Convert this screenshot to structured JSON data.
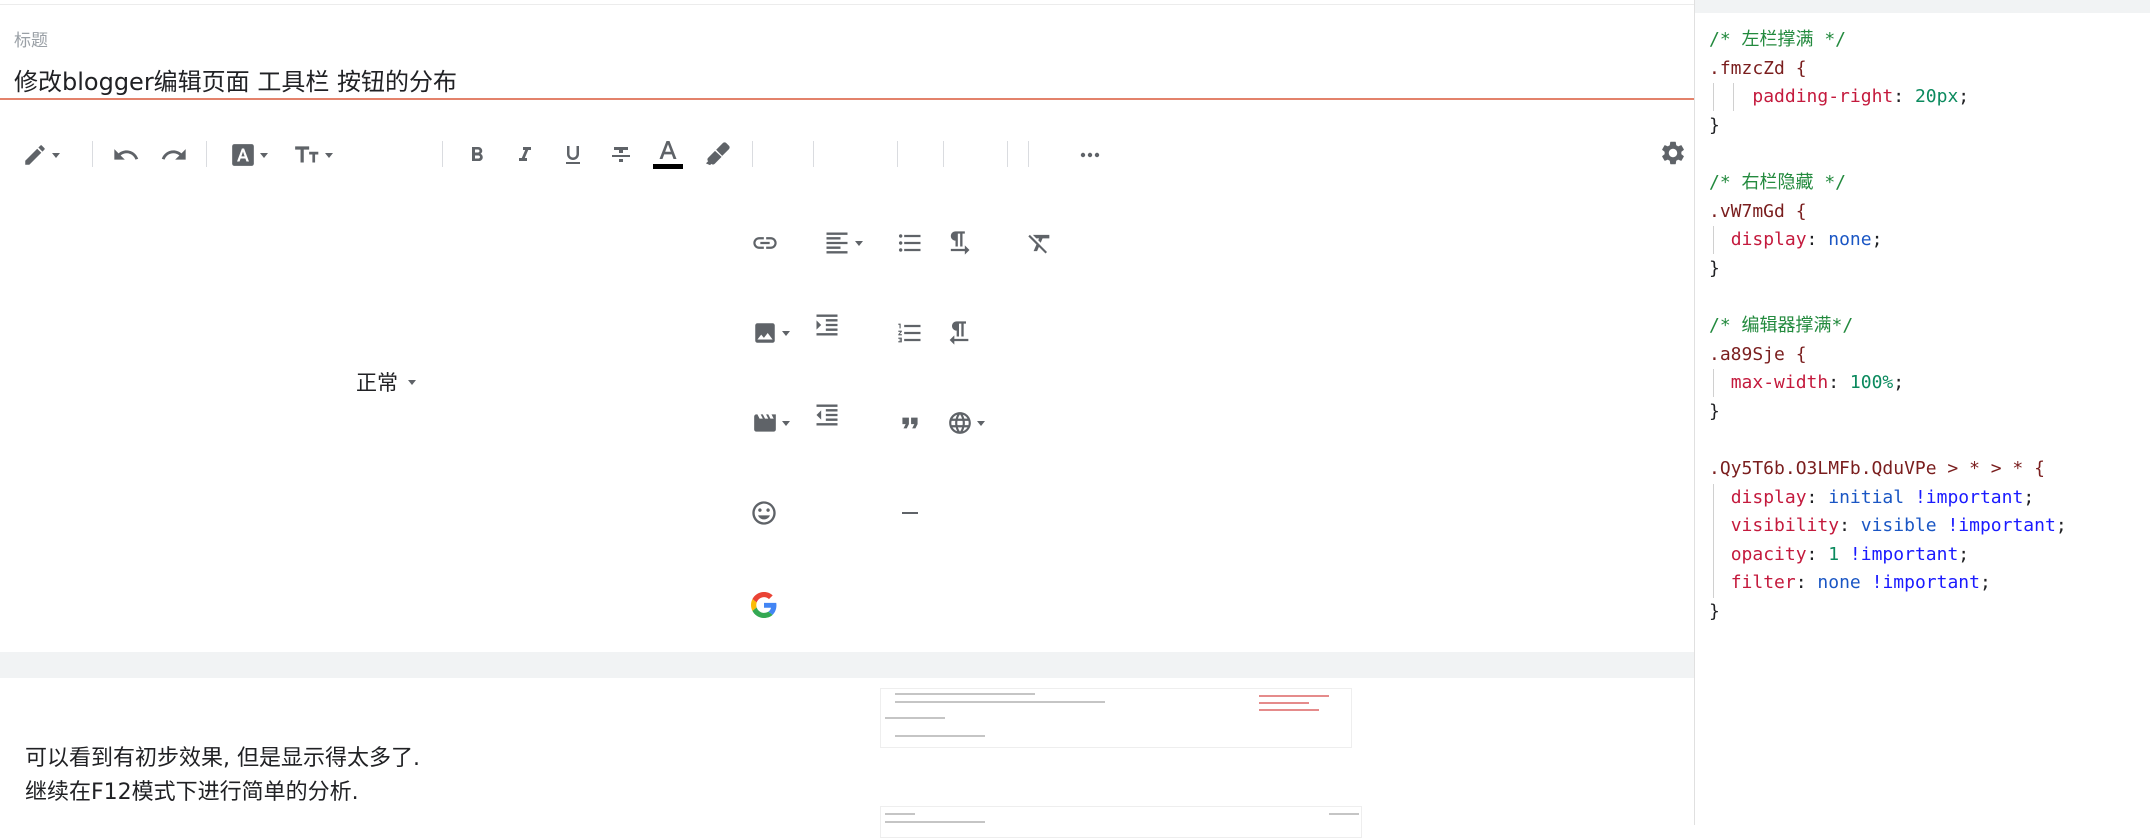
{
  "editor": {
    "title_label": "标题",
    "title_value": "修改blogger编辑页面 工具栏 按钮的分布",
    "format_style": "正常",
    "body_lines": [
      "可以看到有初步效果, 但是显示得太多了.",
      "继续在F12模式下进行简单的分析."
    ]
  },
  "toolbar": {
    "icons": [
      "pencil-mode-icon",
      "undo-icon",
      "redo-icon",
      "font-icon",
      "font-size-icon",
      "bold-icon",
      "italic-icon",
      "underline-icon",
      "strikethrough-icon",
      "text-color-icon",
      "highlight-icon",
      "more-icon",
      "settings-icon",
      "link-icon",
      "align-icon",
      "bulleted-list-icon",
      "ltr-paragraph-icon",
      "clear-format-icon",
      "image-icon",
      "indent-icon",
      "numbered-list-icon",
      "rtl-paragraph-icon",
      "video-icon",
      "outdent-icon",
      "quote-icon",
      "translate-icon",
      "emoji-icon",
      "horizontal-rule-icon",
      "google-icon"
    ]
  },
  "code_panel": {
    "lines": [
      {
        "type": "comment",
        "text": "/* 左栏撑满 */"
      },
      {
        "type": "selector",
        "text": ".fmzcZd {"
      },
      {
        "type": "decl",
        "indent": "    ",
        "prop": "padding-right",
        "value": "20px",
        "value_type": "num"
      },
      {
        "type": "close",
        "text": "}"
      },
      {
        "type": "blank",
        "text": ""
      },
      {
        "type": "comment",
        "text": "/* 右栏隐藏 */"
      },
      {
        "type": "selector",
        "text": ".vW7mGd {"
      },
      {
        "type": "decl",
        "indent": "  ",
        "prop": "display",
        "value": "none",
        "value_type": "kw"
      },
      {
        "type": "close",
        "text": "}"
      },
      {
        "type": "blank",
        "text": ""
      },
      {
        "type": "comment",
        "text": "/* 编辑器撑满*/"
      },
      {
        "type": "selector",
        "text": ".a89Sje {"
      },
      {
        "type": "decl",
        "indent": "  ",
        "prop": "max-width",
        "value": "100%",
        "value_type": "num"
      },
      {
        "type": "close",
        "text": "}"
      },
      {
        "type": "blank",
        "text": ""
      },
      {
        "type": "selector",
        "text": ".Qy5T6b.O3LMFb.QduVPe > * > * {"
      },
      {
        "type": "decl",
        "indent": "  ",
        "prop": "display",
        "value": "initial",
        "value_type": "kw",
        "important": "!important"
      },
      {
        "type": "decl",
        "indent": "  ",
        "prop": "visibility",
        "value": "visible",
        "value_type": "kw",
        "important": "!important"
      },
      {
        "type": "decl",
        "indent": "  ",
        "prop": "opacity",
        "value": "1",
        "value_type": "num",
        "important": "!important"
      },
      {
        "type": "decl",
        "indent": "  ",
        "prop": "filter",
        "value": "none",
        "value_type": "kw",
        "important": "!important"
      },
      {
        "type": "close",
        "text": "}"
      }
    ]
  },
  "colors": {
    "title_underline": "#e3826b",
    "comment": "#238a3e",
    "selector": "#7a1e1e",
    "property": "#c41a3d",
    "number": "#0b8a5e",
    "keyword": "#1a56c4",
    "important": "#1a1aff"
  }
}
